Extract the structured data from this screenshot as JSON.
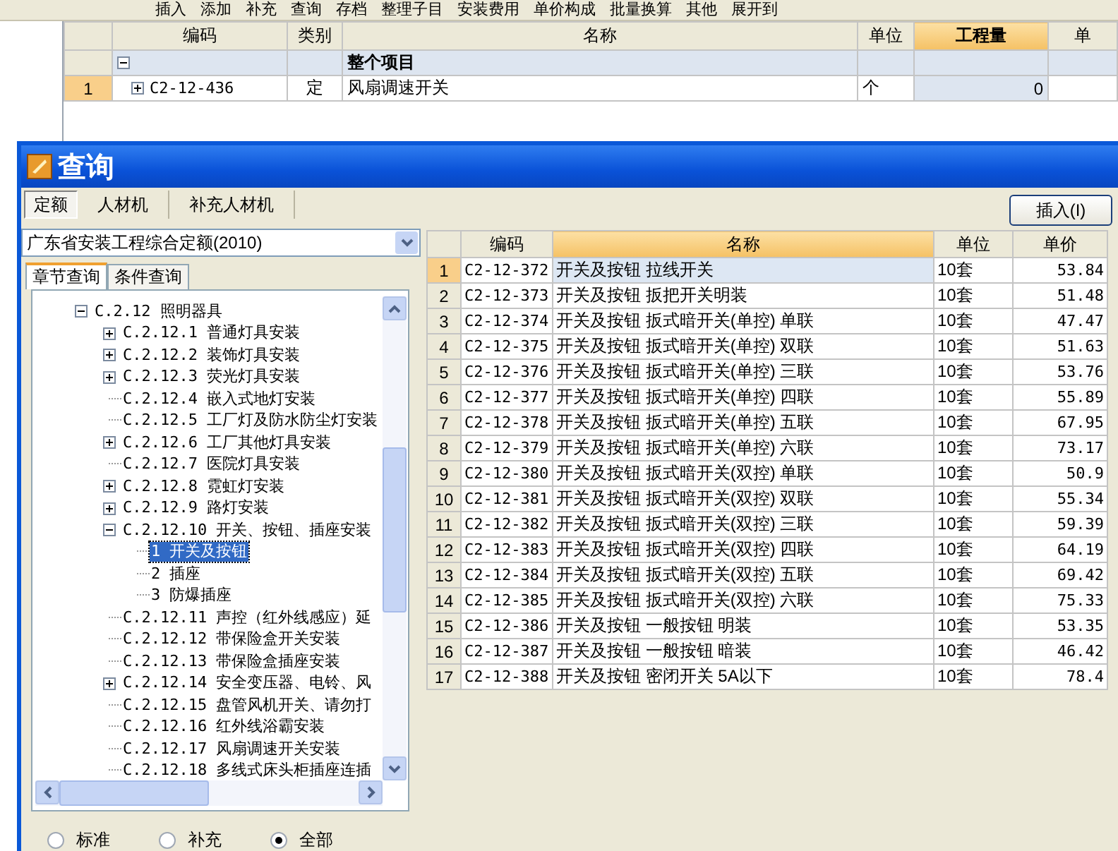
{
  "toolbar": {
    "items": [
      "插入",
      "添加",
      "补充",
      "查询",
      "存档",
      "整理子目",
      "安装费用",
      "单价构成",
      "批量换算",
      "其他",
      "展开到"
    ]
  },
  "project_grid": {
    "columns": [
      {
        "label": "编码",
        "selected": false
      },
      {
        "label": "类别",
        "selected": false
      },
      {
        "label": "名称",
        "selected": false
      },
      {
        "label": "单位",
        "selected": false
      },
      {
        "label": "工程量",
        "selected": true
      },
      {
        "label": "单",
        "selected": false
      }
    ],
    "rows": [
      {
        "kind": "group",
        "expanded": true,
        "name": "整个项目"
      },
      {
        "kind": "item",
        "number": "1",
        "selected": true,
        "expanded": false,
        "code": "C2-12-436",
        "type": "定",
        "name": "风扇调速开关",
        "unit": "个",
        "quantity": "0"
      }
    ]
  },
  "dialog": {
    "title": "查询",
    "tabs": [
      {
        "label": "定额",
        "selected": true
      },
      {
        "label": "人材机",
        "selected": false
      },
      {
        "label": "补充人材机",
        "selected": false
      }
    ],
    "button": "插入(I)",
    "library": "广东省安装工程综合定额(2010)",
    "subtabs": [
      {
        "label": "章节查询",
        "selected": true
      },
      {
        "label": "条件查询",
        "selected": false
      }
    ],
    "tree": [
      {
        "kind": "branch",
        "expanded": true,
        "selected": false,
        "label": "C.2.12 照明器具",
        "children": [
          {
            "kind": "branch",
            "expanded": false,
            "selected": false,
            "label": "C.2.12.1 普通灯具安装"
          },
          {
            "kind": "branch",
            "expanded": false,
            "selected": false,
            "label": "C.2.12.2 装饰灯具安装"
          },
          {
            "kind": "branch",
            "expanded": false,
            "selected": false,
            "label": "C.2.12.3 荧光灯具安装"
          },
          {
            "kind": "leaf",
            "selected": false,
            "label": "C.2.12.4 嵌入式地灯安装"
          },
          {
            "kind": "leaf",
            "selected": false,
            "label": "C.2.12.5 工厂灯及防水防尘灯安装"
          },
          {
            "kind": "branch",
            "expanded": false,
            "selected": false,
            "label": "C.2.12.6 工厂其他灯具安装"
          },
          {
            "kind": "leaf",
            "selected": false,
            "label": "C.2.12.7 医院灯具安装"
          },
          {
            "kind": "branch",
            "expanded": false,
            "selected": false,
            "label": "C.2.12.8 霓虹灯安装"
          },
          {
            "kind": "branch",
            "expanded": false,
            "selected": false,
            "label": "C.2.12.9 路灯安装"
          },
          {
            "kind": "branch",
            "expanded": true,
            "selected": false,
            "label": "C.2.12.10 开关、按钮、插座安装",
            "children": [
              {
                "kind": "leaf",
                "selected": true,
                "label": "1 开关及按钮"
              },
              {
                "kind": "leaf",
                "selected": false,
                "label": "2 插座"
              },
              {
                "kind": "leaf",
                "selected": false,
                "label": "3 防爆插座"
              }
            ]
          },
          {
            "kind": "leaf",
            "selected": false,
            "label": "C.2.12.11 声控（红外线感应）延"
          },
          {
            "kind": "leaf",
            "selected": false,
            "label": "C.2.12.12 带保险盒开关安装"
          },
          {
            "kind": "leaf",
            "selected": false,
            "label": "C.2.12.13 带保险盒插座安装"
          },
          {
            "kind": "branch",
            "expanded": false,
            "selected": false,
            "label": "C.2.12.14 安全变压器、电铃、风"
          },
          {
            "kind": "leaf",
            "selected": false,
            "label": "C.2.12.15 盘管风机开关、请勿打"
          },
          {
            "kind": "leaf",
            "selected": false,
            "label": "C.2.12.16 红外线浴霸安装"
          },
          {
            "kind": "leaf",
            "selected": false,
            "label": "C.2.12.17 风扇调速开关安装"
          },
          {
            "kind": "leaf",
            "selected": false,
            "label": "C.2.12.18 多线式床头柜插座连插"
          }
        ]
      }
    ],
    "filters": [
      {
        "label": "标准",
        "selected": false
      },
      {
        "label": "补充",
        "selected": false
      },
      {
        "label": "全部",
        "selected": true
      }
    ],
    "results": {
      "columns": [
        {
          "label": "编码",
          "selected": false
        },
        {
          "label": "名称",
          "selected": true
        },
        {
          "label": "单位",
          "selected": false
        },
        {
          "label": "单价",
          "selected": false
        }
      ],
      "rows": [
        {
          "number": "1",
          "code": "C2-12-372",
          "name": "开关及按钮 拉线开关",
          "unit": "10套",
          "price": "53.84",
          "selected": true
        },
        {
          "number": "2",
          "code": "C2-12-373",
          "name": "开关及按钮 扳把开关明装",
          "unit": "10套",
          "price": "51.48",
          "selected": false
        },
        {
          "number": "3",
          "code": "C2-12-374",
          "name": "开关及按钮 扳式暗开关(单控) 单联",
          "unit": "10套",
          "price": "47.47",
          "selected": false
        },
        {
          "number": "4",
          "code": "C2-12-375",
          "name": "开关及按钮 扳式暗开关(单控) 双联",
          "unit": "10套",
          "price": "51.63",
          "selected": false
        },
        {
          "number": "5",
          "code": "C2-12-376",
          "name": "开关及按钮 扳式暗开关(单控) 三联",
          "unit": "10套",
          "price": "53.76",
          "selected": false
        },
        {
          "number": "6",
          "code": "C2-12-377",
          "name": "开关及按钮 扳式暗开关(单控) 四联",
          "unit": "10套",
          "price": "55.89",
          "selected": false
        },
        {
          "number": "7",
          "code": "C2-12-378",
          "name": "开关及按钮 扳式暗开关(单控) 五联",
          "unit": "10套",
          "price": "67.95",
          "selected": false
        },
        {
          "number": "8",
          "code": "C2-12-379",
          "name": "开关及按钮 扳式暗开关(单控) 六联",
          "unit": "10套",
          "price": "73.17",
          "selected": false
        },
        {
          "number": "9",
          "code": "C2-12-380",
          "name": "开关及按钮 扳式暗开关(双控) 单联",
          "unit": "10套",
          "price": "50.9",
          "selected": false
        },
        {
          "number": "10",
          "code": "C2-12-381",
          "name": "开关及按钮 扳式暗开关(双控) 双联",
          "unit": "10套",
          "price": "55.34",
          "selected": false
        },
        {
          "number": "11",
          "code": "C2-12-382",
          "name": "开关及按钮 扳式暗开关(双控) 三联",
          "unit": "10套",
          "price": "59.39",
          "selected": false
        },
        {
          "number": "12",
          "code": "C2-12-383",
          "name": "开关及按钮 扳式暗开关(双控) 四联",
          "unit": "10套",
          "price": "64.19",
          "selected": false
        },
        {
          "number": "13",
          "code": "C2-12-384",
          "name": "开关及按钮 扳式暗开关(双控) 五联",
          "unit": "10套",
          "price": "69.42",
          "selected": false
        },
        {
          "number": "14",
          "code": "C2-12-385",
          "name": "开关及按钮 扳式暗开关(双控) 六联",
          "unit": "10套",
          "price": "75.33",
          "selected": false
        },
        {
          "number": "15",
          "code": "C2-12-386",
          "name": "开关及按钮 一般按钮 明装",
          "unit": "10套",
          "price": "53.35",
          "selected": false
        },
        {
          "number": "16",
          "code": "C2-12-387",
          "name": "开关及按钮 一般按钮 暗装",
          "unit": "10套",
          "price": "46.42",
          "selected": false
        },
        {
          "number": "17",
          "code": "C2-12-388",
          "name": "开关及按钮 密闭开关 5A以下",
          "unit": "10套",
          "price": "78.4",
          "selected": false
        }
      ]
    }
  }
}
